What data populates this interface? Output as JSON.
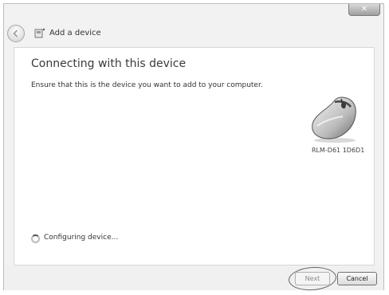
{
  "window": {
    "close_label": "✕"
  },
  "header": {
    "title": "Add a device"
  },
  "main": {
    "heading": "Connecting with this device",
    "instruction": "Ensure that this is the device you want to add to your computer.",
    "device_name": "RLM-D61 1D6D1",
    "status": "Configuring device..."
  },
  "footer": {
    "next_label": "Next",
    "cancel_label": "Cancel"
  }
}
